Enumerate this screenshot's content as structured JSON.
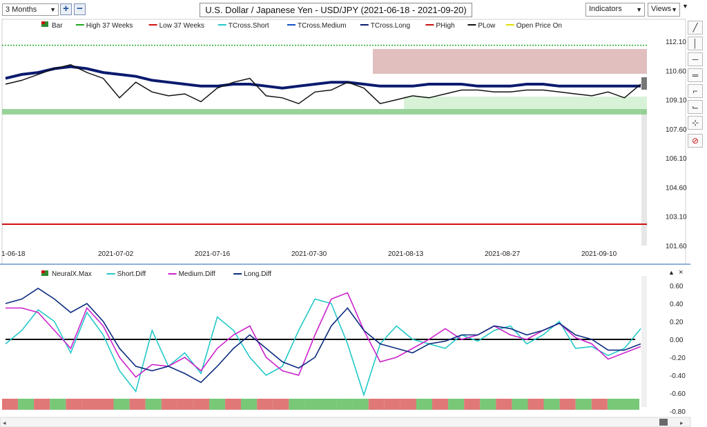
{
  "toolbar": {
    "period": "3 Months",
    "title": "U.S. Dollar / Japanese Yen - USD/JPY (2021-06-18 - 2021-09-20)",
    "indicators": "Indicators",
    "views": "Views"
  },
  "main_legend": [
    "Bar",
    "High 37 Weeks",
    "Low 37 Weeks",
    "TCross.Short",
    "TCross.Medium",
    "TCross.Long",
    "PHigh",
    "PLow",
    "Open Price On"
  ],
  "main_legend_colors": [
    "#2e8b2e",
    "#1aa51a",
    "#d01010",
    "#22c8c8",
    "#1050c8",
    "#0a1a6e",
    "#c81010",
    "#111111",
    "#e0e000"
  ],
  "price_axis": [
    "112.10",
    "110.60",
    "109.10",
    "107.60",
    "106.10",
    "104.60",
    "103.10",
    "101.60"
  ],
  "date_axis": [
    "1-06-18",
    "2021-07-02",
    "2021-07-16",
    "2021-07-30",
    "2021-08-13",
    "2021-08-27",
    "2021-09-10"
  ],
  "osc_legend": [
    "NeuralX.Max",
    "Short.Diff",
    "Medium.Diff",
    "Long.Diff"
  ],
  "osc_legend_colors": [
    "#2e8b2e",
    "#22c8c8",
    "#cc22cc",
    "#0a2a7e"
  ],
  "osc_axis": [
    "0.60",
    "0.40",
    "0.20",
    "0.00",
    "-0.20",
    "-0.40",
    "-0.60",
    "-0.80"
  ],
  "chart_data": {
    "type": "line",
    "title": "U.S. Dollar / Japanese Yen - USD/JPY (2021-06-18 - 2021-09-20)",
    "price_ylim": [
      101.6,
      112.1
    ],
    "low_37_weeks": 102.7,
    "high_37_weeks": 111.9,
    "series": [
      {
        "name": "TCross.Long",
        "values": [
          110.2,
          110.4,
          110.5,
          110.7,
          110.8,
          110.7,
          110.5,
          110.4,
          110.3,
          110.1,
          110.0,
          109.9,
          109.8,
          109.8,
          109.9,
          109.9,
          109.8,
          109.7,
          109.8,
          109.9,
          110.0,
          110.0,
          109.9,
          109.8,
          109.8,
          109.8,
          109.9,
          109.9,
          109.9,
          109.8,
          109.8,
          109.8,
          109.9,
          109.9,
          109.8,
          109.8,
          109.8,
          109.8,
          109.8,
          109.8
        ]
      },
      {
        "name": "PLow",
        "values": [
          109.9,
          110.1,
          110.4,
          110.7,
          110.9,
          110.5,
          110.2,
          109.2,
          110.0,
          109.5,
          109.3,
          109.4,
          109.0,
          109.7,
          110.0,
          110.2,
          109.3,
          109.2,
          108.9,
          109.5,
          109.6,
          110.0,
          109.7,
          108.9,
          109.1,
          109.3,
          109.2,
          109.4,
          109.6,
          109.6,
          109.5,
          109.5,
          109.6,
          109.6,
          109.5,
          109.4,
          109.3,
          109.5,
          109.2,
          109.9
        ]
      },
      {
        "name": "Short.Diff",
        "values": [
          -0.05,
          0.1,
          0.33,
          0.2,
          -0.15,
          0.3,
          0.05,
          -0.35,
          -0.58,
          0.1,
          -0.3,
          -0.15,
          -0.38,
          0.25,
          0.1,
          -0.2,
          -0.4,
          -0.3,
          0.1,
          0.45,
          0.4,
          -0.05,
          -0.62,
          -0.05,
          0.15,
          0.0,
          -0.05,
          -0.1,
          0.05,
          -0.02,
          0.1,
          0.15,
          -0.05,
          0.05,
          0.2,
          -0.1,
          -0.08,
          -0.18,
          -0.1,
          0.12
        ]
      },
      {
        "name": "Medium.Diff",
        "values": [
          0.35,
          0.35,
          0.3,
          0.1,
          -0.1,
          0.35,
          0.15,
          -0.2,
          -0.42,
          -0.28,
          -0.3,
          -0.2,
          -0.35,
          -0.1,
          0.05,
          0.15,
          -0.2,
          -0.35,
          -0.4,
          0.05,
          0.45,
          0.52,
          0.1,
          -0.25,
          -0.2,
          -0.1,
          0.0,
          0.12,
          0.0,
          0.05,
          0.15,
          0.05,
          0.0,
          0.1,
          0.18,
          0.02,
          -0.05,
          -0.22,
          -0.15,
          -0.08
        ]
      },
      {
        "name": "Long.Diff",
        "values": [
          0.4,
          0.45,
          0.57,
          0.45,
          0.3,
          0.4,
          0.2,
          -0.1,
          -0.3,
          -0.35,
          -0.3,
          -0.38,
          -0.48,
          -0.3,
          -0.1,
          0.05,
          -0.1,
          -0.25,
          -0.32,
          -0.2,
          0.15,
          0.35,
          0.1,
          -0.05,
          -0.1,
          -0.15,
          -0.05,
          -0.02,
          0.05,
          0.05,
          0.15,
          0.12,
          0.05,
          0.1,
          0.18,
          0.05,
          0.0,
          -0.12,
          -0.12,
          -0.05
        ]
      }
    ],
    "neuralx_max": [
      "red",
      "green",
      "red",
      "green",
      "red",
      "red",
      "red",
      "green",
      "red",
      "green",
      "red",
      "red",
      "red",
      "green",
      "red",
      "green",
      "red",
      "red",
      "green",
      "green",
      "green",
      "green",
      "green",
      "red",
      "red",
      "red",
      "green",
      "red",
      "green",
      "red",
      "green",
      "red",
      "green",
      "red",
      "green",
      "red",
      "green",
      "red",
      "green",
      "green"
    ],
    "osc_ylim": [
      -0.8,
      0.6
    ]
  }
}
